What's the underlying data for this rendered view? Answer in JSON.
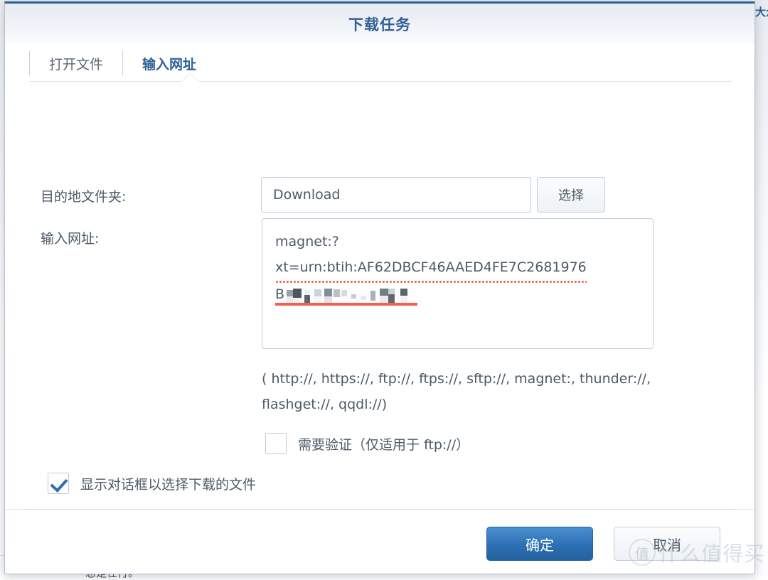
{
  "backdrop": {
    "right_edge_text": "大众",
    "bottom_clipped_text": "总是在行。"
  },
  "dialog": {
    "title": "下载任务",
    "tabs": [
      {
        "label": "打开文件",
        "active": false
      },
      {
        "label": "输入网址",
        "active": true
      }
    ],
    "fields": {
      "destination_label": "目的地文件夹:",
      "destination_value": "Download",
      "destination_placeholder": "Download",
      "select_button_label": "选择",
      "url_label": "输入网址:",
      "url_lines": [
        "magnet:?",
        "xt=urn:btih:AF62DBCF46AAED4FE7C2681976",
        "B"
      ],
      "url_value": "magnet:?xt=urn:btih:AF62DBCF46AAED4FE7C2681976B",
      "url_redacted": true,
      "protocol_hint": "( http://, https://, ftp://, ftps://, sftp://, magnet:, thunder://, flashget://, qqdl://)"
    },
    "checkboxes": [
      {
        "label": "需要验证（仅适用于 ftp://）",
        "checked": false
      },
      {
        "label": "显示对话框以选择下载的文件",
        "checked": true
      }
    ],
    "footer": {
      "ok_label": "确定",
      "cancel_label": "取消"
    }
  },
  "watermark": {
    "badge": "值",
    "text": "什么值得买"
  },
  "colors": {
    "title_blue": "#2f5f96",
    "accent_button": "#2d6fb3",
    "text": "#4c5a67",
    "border": "#c2ccd7",
    "spellcheck_red": "#f4604d"
  }
}
